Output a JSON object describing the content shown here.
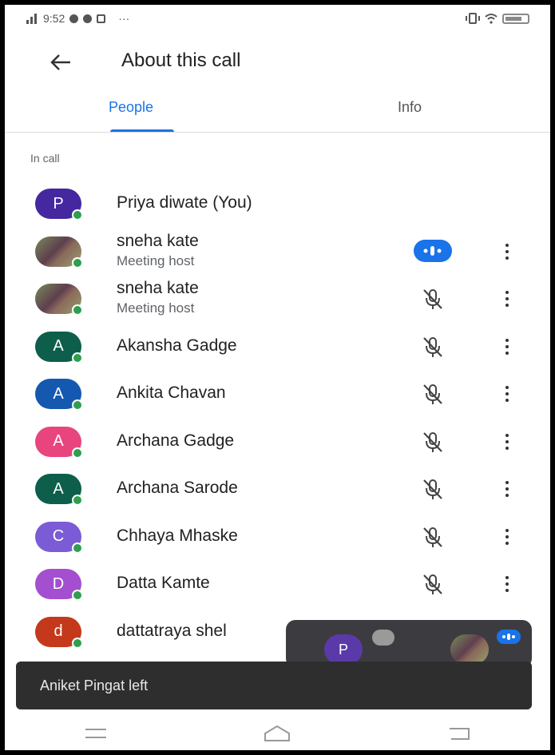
{
  "status_bar": {
    "time": "9:52",
    "ellipsis": "···"
  },
  "header": {
    "title": "About this call"
  },
  "tabs": [
    {
      "label": "People"
    },
    {
      "label": "Info"
    }
  ],
  "section_label": "In call",
  "participants": [
    {
      "name": "Priya diwate (You)",
      "initial": "P",
      "avatar_color": "#4527a0",
      "subtitle": "",
      "mic": "none"
    },
    {
      "name": "sneha kate",
      "initial": "",
      "avatar_color": "",
      "subtitle": "Meeting host",
      "mic": "speaking"
    },
    {
      "name": "sneha kate",
      "initial": "",
      "avatar_color": "",
      "subtitle": "Meeting host",
      "mic": "muted"
    },
    {
      "name": "Akansha Gadge",
      "initial": "A",
      "avatar_color": "#0d5e4a",
      "subtitle": "",
      "mic": "muted"
    },
    {
      "name": "Ankita Chavan",
      "initial": "A",
      "avatar_color": "#1558b0",
      "subtitle": "",
      "mic": "muted"
    },
    {
      "name": "Archana Gadge",
      "initial": "A",
      "avatar_color": "#e8457e",
      "subtitle": "",
      "mic": "muted"
    },
    {
      "name": "Archana Sarode",
      "initial": "A",
      "avatar_color": "#0d5e4a",
      "subtitle": "",
      "mic": "muted"
    },
    {
      "name": "Chhaya Mhaske",
      "initial": "C",
      "avatar_color": "#7b5cd6",
      "subtitle": "",
      "mic": "muted"
    },
    {
      "name": "Datta Kamte",
      "initial": "D",
      "avatar_color": "#a34fcf",
      "subtitle": "",
      "mic": "muted"
    },
    {
      "name": "dattatraya shel",
      "initial": "d",
      "avatar_color": "#c4391c",
      "subtitle": "",
      "mic": "none"
    }
  ],
  "pip": {
    "self_initial": "P"
  },
  "snackbar": {
    "message": "Aniket Pingat left"
  },
  "colors": {
    "accent": "#1a73e8",
    "presence": "#2e9e4f"
  }
}
